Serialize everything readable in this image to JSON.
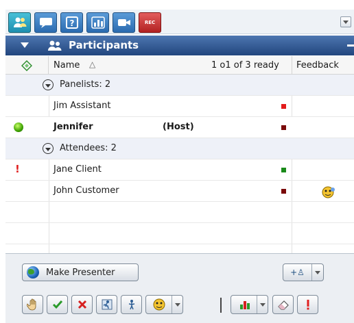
{
  "toolbar": {
    "buttons": [
      {
        "icon": "participants-icon",
        "active": true
      },
      {
        "icon": "chat-icon"
      },
      {
        "icon": "help-icon"
      },
      {
        "icon": "poll-icon"
      },
      {
        "icon": "video-icon"
      },
      {
        "icon": "record-icon",
        "label": "REC"
      }
    ],
    "menu_icon": "panel-options-icon"
  },
  "header": {
    "title": "Participants"
  },
  "columns": {
    "name": "Name",
    "sort_indicator": "△",
    "ready": "1 o1 of 3 ready",
    "feedback": "Feedback"
  },
  "groups": [
    {
      "label": "Panelists: 2",
      "members": [
        {
          "name": "Jim Assistant",
          "role": "",
          "status_color": "#e31b1b",
          "bold": false
        },
        {
          "name": "Jennifer",
          "role": "(Host)",
          "status_color": "#7a0a0a",
          "bold": true,
          "presenter": true
        }
      ]
    },
    {
      "label": "Attendees: 2",
      "members": [
        {
          "name": "Jane Client",
          "role": "",
          "status_color": "#1a8a1a",
          "bold": false,
          "alert": "!"
        },
        {
          "name": "John Customer",
          "role": "",
          "status_color": "#7a0a0a",
          "bold": false,
          "feedback": "emoticon-icon"
        }
      ]
    }
  ],
  "actions": {
    "make_presenter": "Make Presenter",
    "add_label": "+♙"
  },
  "feedback_bar": [
    "raise-hand-icon",
    "check-icon",
    "cross-icon",
    "speed-up-icon",
    "slow-down-icon",
    "emoticon-icon",
    "bar-chart-icon",
    "eraser-icon",
    "exclamation-icon"
  ]
}
